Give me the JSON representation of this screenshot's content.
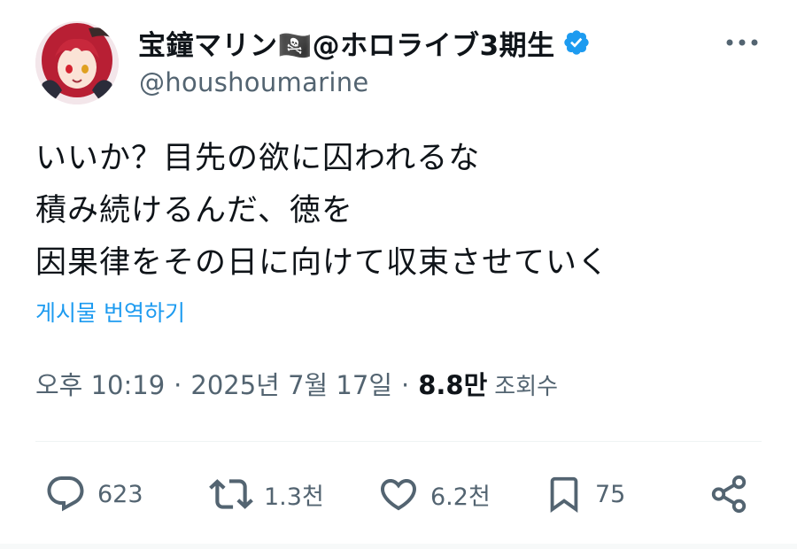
{
  "author": {
    "display_name": "宝鐘マリン🏴‍☠️@ホロライブ3期生",
    "handle": "@houshoumarine",
    "verified": true
  },
  "tweet": {
    "lines": [
      "いいか？目先の欲に囚われるな",
      "積み続けるんだ、徳を",
      "因果律をその日に向けて収束させていく"
    ],
    "translate_label": "게시물 번역하기"
  },
  "meta": {
    "time": "오후 10:19",
    "date": "2025년 7월 17일",
    "views_count": "8.8만",
    "views_label": "조회수"
  },
  "actions": {
    "reply_count": "623",
    "retweet_count": "1.3천",
    "like_count": "6.2천",
    "bookmark_count": "75"
  },
  "icons": {
    "avatar": "avatar-image",
    "verified": "verified-badge-icon",
    "more": "more-icon",
    "reply": "reply-icon",
    "retweet": "retweet-icon",
    "like": "heart-icon",
    "bookmark": "bookmark-icon",
    "share": "share-icon"
  },
  "colors": {
    "accent": "#1d9bf0",
    "text": "#0f1419",
    "secondary": "#536471"
  }
}
